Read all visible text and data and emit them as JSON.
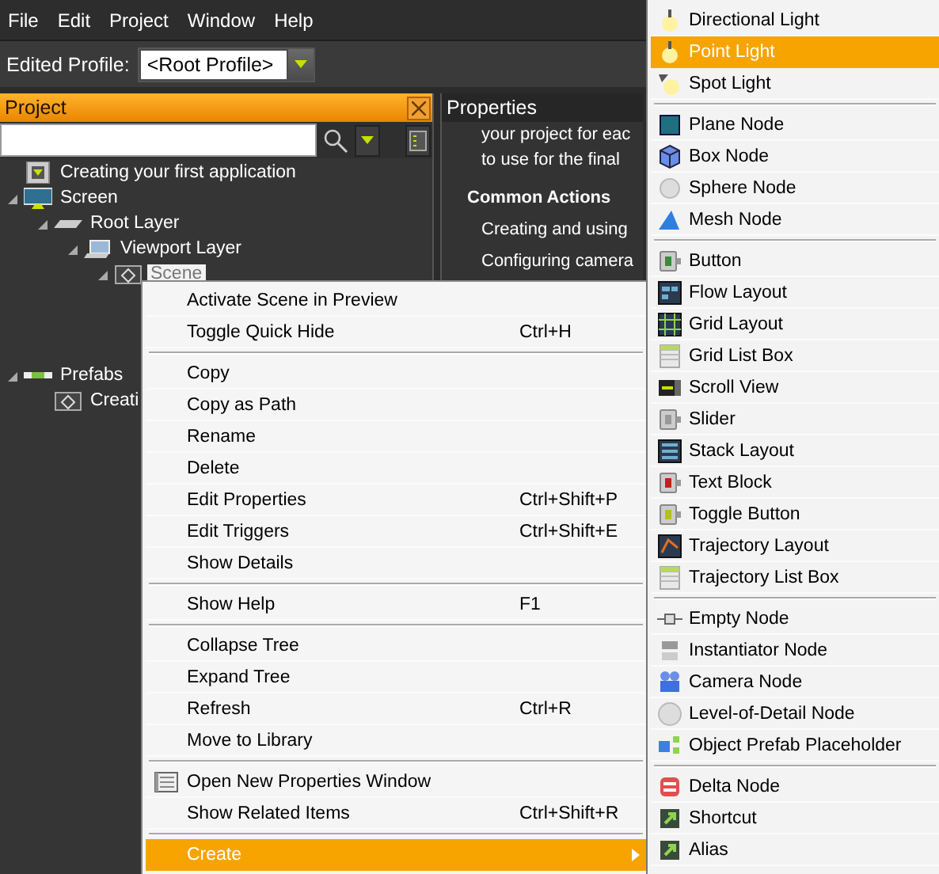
{
  "menu_bar": [
    {
      "label": "File"
    },
    {
      "label": "Edit"
    },
    {
      "label": "Project"
    },
    {
      "label": "Window"
    },
    {
      "label": "Help"
    }
  ],
  "toolbar": {
    "label": "Edited Profile:",
    "profile": "<Root Profile>"
  },
  "project_panel": {
    "title": "Project",
    "tree": [
      {
        "label": "Creating your first application",
        "kind": "doc",
        "selected": false
      },
      {
        "label": "Screen",
        "kind": "screen",
        "expanded": true,
        "selected": false,
        "children": [
          {
            "label": "Root Layer",
            "kind": "layer",
            "expanded": true,
            "selected": false,
            "children": [
              {
                "label": "Viewport Layer",
                "kind": "viewport",
                "expanded": true,
                "selected": false,
                "children": [
                  {
                    "label": "Scene",
                    "kind": "scene",
                    "expanded": true,
                    "selected": true
                  }
                ]
              }
            ]
          }
        ]
      },
      {
        "label": "Prefabs",
        "kind": "prefabs",
        "expanded": true,
        "selected": false,
        "children": [
          {
            "label": "Creati",
            "kind": "scene",
            "selected": false
          }
        ]
      }
    ]
  },
  "properties_panel": {
    "title": "Properties",
    "lines": [
      {
        "text": "your project for eac",
        "kind": "body"
      },
      {
        "text": "to use for the final",
        "kind": "body"
      },
      {
        "text": "Common Actions",
        "kind": "heading"
      },
      {
        "text": "Creating and using",
        "kind": "link"
      },
      {
        "text": "Configuring camera",
        "kind": "link"
      }
    ]
  },
  "context_menu": {
    "groups": [
      [
        {
          "label": "Activate Scene in Preview",
          "selected": false
        },
        {
          "label": "Toggle Quick Hide",
          "shortcut": "Ctrl+H",
          "selected": false
        }
      ],
      [
        {
          "label": "Copy",
          "selected": false
        },
        {
          "label": "Copy as Path",
          "selected": false
        },
        {
          "label": "Rename",
          "selected": false
        },
        {
          "label": "Delete",
          "selected": false
        },
        {
          "label": "Edit Properties",
          "shortcut": "Ctrl+Shift+P",
          "selected": false
        },
        {
          "label": "Edit Triggers",
          "shortcut": "Ctrl+Shift+E",
          "selected": false
        },
        {
          "label": "Show Details",
          "selected": false
        }
      ],
      [
        {
          "label": "Show Help",
          "shortcut": "F1",
          "selected": false
        }
      ],
      [
        {
          "label": "Collapse Tree",
          "selected": false
        },
        {
          "label": "Expand Tree",
          "selected": false
        },
        {
          "label": "Refresh",
          "shortcut": "Ctrl+R",
          "selected": false
        },
        {
          "label": "Move to Library",
          "selected": false
        }
      ],
      [
        {
          "label": "Open New Properties Window",
          "has_icon": true,
          "selected": false
        },
        {
          "label": "Show Related Items",
          "shortcut": "Ctrl+Shift+R",
          "selected": false
        }
      ],
      [
        {
          "label": "Create",
          "has_submenu": true,
          "selected": true
        }
      ]
    ]
  },
  "create_submenu": {
    "groups": [
      [
        {
          "label": "Directional Light",
          "selected": false
        },
        {
          "label": "Point Light",
          "selected": true
        },
        {
          "label": "Spot Light",
          "selected": false
        }
      ],
      [
        {
          "label": "Plane Node",
          "selected": false
        },
        {
          "label": "Box Node",
          "selected": false
        },
        {
          "label": "Sphere Node",
          "selected": false
        },
        {
          "label": "Mesh Node",
          "selected": false
        }
      ],
      [
        {
          "label": "Button",
          "selected": false
        },
        {
          "label": "Flow Layout",
          "selected": false
        },
        {
          "label": "Grid Layout",
          "selected": false
        },
        {
          "label": "Grid List Box",
          "selected": false
        },
        {
          "label": "Scroll View",
          "selected": false
        },
        {
          "label": "Slider",
          "selected": false
        },
        {
          "label": "Stack Layout",
          "selected": false
        },
        {
          "label": "Text Block",
          "selected": false
        },
        {
          "label": "Toggle Button",
          "selected": false
        },
        {
          "label": "Trajectory Layout",
          "selected": false
        },
        {
          "label": "Trajectory List Box",
          "selected": false
        }
      ],
      [
        {
          "label": "Empty Node",
          "selected": false
        },
        {
          "label": "Instantiator Node",
          "selected": false
        },
        {
          "label": "Camera Node",
          "selected": false
        },
        {
          "label": "Level-of-Detail Node",
          "selected": false
        },
        {
          "label": "Object Prefab Placeholder",
          "selected": false
        }
      ],
      [
        {
          "label": "Delta Node",
          "selected": false
        },
        {
          "label": "Shortcut",
          "selected": false
        },
        {
          "label": "Alias",
          "selected": false
        }
      ]
    ]
  }
}
